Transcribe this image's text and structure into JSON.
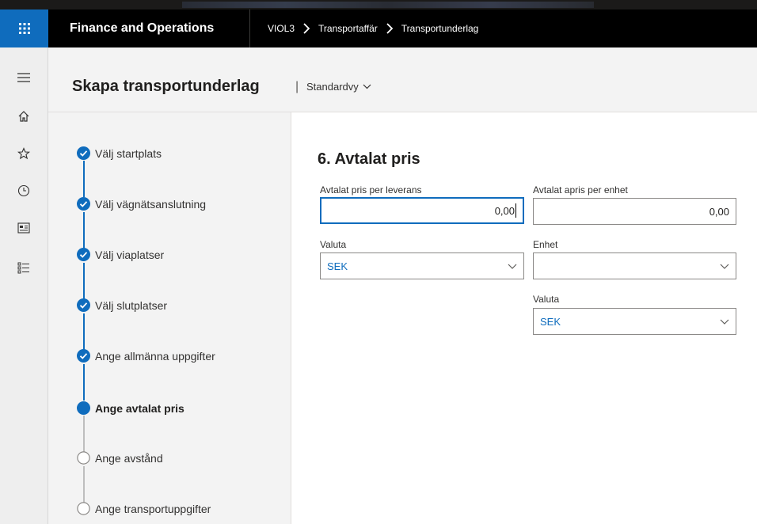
{
  "app": {
    "title": "Finance and Operations"
  },
  "breadcrumb": [
    "VIOL3",
    "Transportaffär",
    "Transportunderlag"
  ],
  "rail_icons": [
    "hamburger-icon",
    "home-icon",
    "star-icon",
    "clock-icon",
    "workspace-icon",
    "list-icon"
  ],
  "page": {
    "title": "Skapa transportunderlag",
    "separator": "|",
    "view": "Standardvy"
  },
  "steps": [
    {
      "label": "Välj startplats",
      "state": "done"
    },
    {
      "label": "Välj vägnätsanslutning",
      "state": "done"
    },
    {
      "label": "Välj viaplatser",
      "state": "done"
    },
    {
      "label": "Välj slutplatser",
      "state": "done"
    },
    {
      "label": "Ange allmänna uppgifter",
      "state": "done"
    },
    {
      "label": "Ange avtalat pris",
      "state": "active"
    },
    {
      "label": "Ange avstånd",
      "state": "pending"
    },
    {
      "label": "Ange transportuppgifter",
      "state": "pending"
    }
  ],
  "form": {
    "section_title": "6. Avtalat pris",
    "price_per_delivery": {
      "label": "Avtalat pris per leverans",
      "value": "0,00"
    },
    "price_per_unit": {
      "label": "Avtalat apris per enhet",
      "value": "0,00"
    },
    "currency_left": {
      "label": "Valuta",
      "value": "SEK"
    },
    "unit": {
      "label": "Enhet",
      "value": ""
    },
    "currency_right": {
      "label": "Valuta",
      "value": "SEK"
    }
  },
  "colors": {
    "accent": "#0f6cbd",
    "navbar": "#000000",
    "panel": "#f3f3f3"
  }
}
